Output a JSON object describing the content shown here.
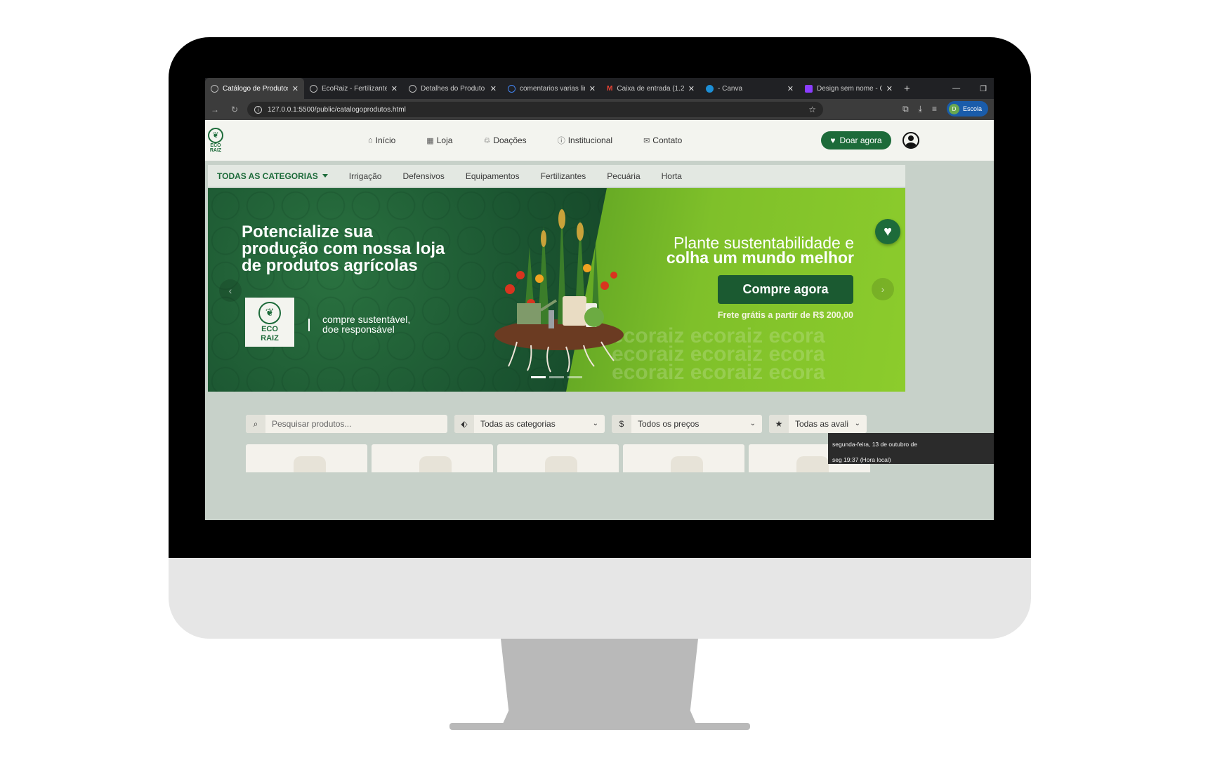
{
  "browser": {
    "tabs": [
      {
        "title": "Catálogo de Produtos",
        "active": true,
        "icon": "globe-icon"
      },
      {
        "title": "EcoRaiz - Fertilizantes",
        "active": false,
        "icon": "globe-icon"
      },
      {
        "title": "Detalhes do Produto",
        "active": false,
        "icon": "globe-icon"
      },
      {
        "title": "comentarios varias linhas",
        "active": false,
        "icon": "google-icon"
      },
      {
        "title": "Caixa de entrada (1.2",
        "active": false,
        "icon": "gmail-icon"
      },
      {
        "title": "- Canva",
        "active": false,
        "icon": "canva-icon"
      },
      {
        "title": "Design sem nome - Canva",
        "active": false,
        "icon": "canva-design-icon"
      }
    ],
    "url": "127.0.0.1:5500/public/catalogoprodutos.html",
    "profile_label": "Escola",
    "profile_initial": "D"
  },
  "site": {
    "logo_text_1": "ECO",
    "logo_text_2": "RAIZ",
    "nav": [
      {
        "label": "Início",
        "icon": "home-icon"
      },
      {
        "label": "Loja",
        "icon": "store-icon"
      },
      {
        "label": "Doações",
        "icon": "recycle-icon"
      },
      {
        "label": "Institucional",
        "icon": "info-icon"
      },
      {
        "label": "Contato",
        "icon": "mail-icon"
      }
    ],
    "donate_label": "Doar agora"
  },
  "categories": {
    "all_label": "TODAS AS CATEGORIAS",
    "items": [
      "Irrigação",
      "Defensivos",
      "Equipamentos",
      "Fertilizantes",
      "Pecuária",
      "Horta"
    ]
  },
  "hero": {
    "title": "Potencialize sua produção com nossa loja de produtos agrícolas",
    "logo_1": "ECO",
    "logo_2": "RAIZ",
    "tagline_1": "compre sustentável,",
    "tagline_2": "doe responsável",
    "slogan_1": "Plante sustentabilidade e",
    "slogan_2": "colha um mundo melhor",
    "cta": "Compre agora",
    "shipping": "Frete grátis a partir de R$ 200,00",
    "watermark": "ecoraiz ecoraiz ecora",
    "slides_total": 3,
    "slide_active": 1
  },
  "filters": {
    "search_placeholder": "Pesquisar produtos...",
    "category": "Todas as categorias",
    "price": "Todos os preços",
    "rating": "Todas as avali"
  },
  "tooltip": {
    "line1": "segunda-feira, 13 de outubro de",
    "line2": "seg 19:37 (Hora local)"
  },
  "colors": {
    "brand_green": "#1d6b3a",
    "hero_lime": "#7fc02a",
    "page_bg": "#c7d1c9"
  }
}
